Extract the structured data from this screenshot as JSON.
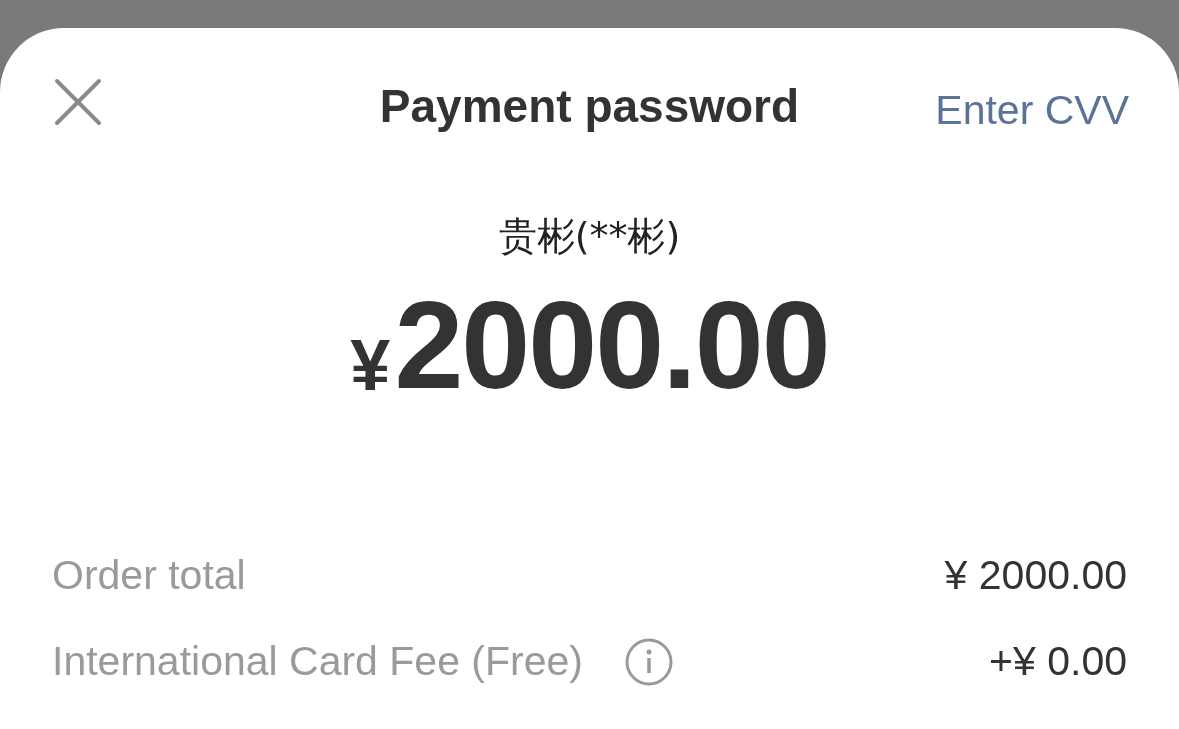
{
  "header": {
    "title": "Payment password",
    "action": "Enter CVV"
  },
  "payee": "贵彬(**彬)",
  "amount": {
    "currency": "¥",
    "value": "2000.00"
  },
  "rows": [
    {
      "label": "Order total",
      "value": "¥ 2000.00",
      "info": false
    },
    {
      "label": "International Card Fee (Free)",
      "value": "+¥ 0.00",
      "info": true
    }
  ]
}
